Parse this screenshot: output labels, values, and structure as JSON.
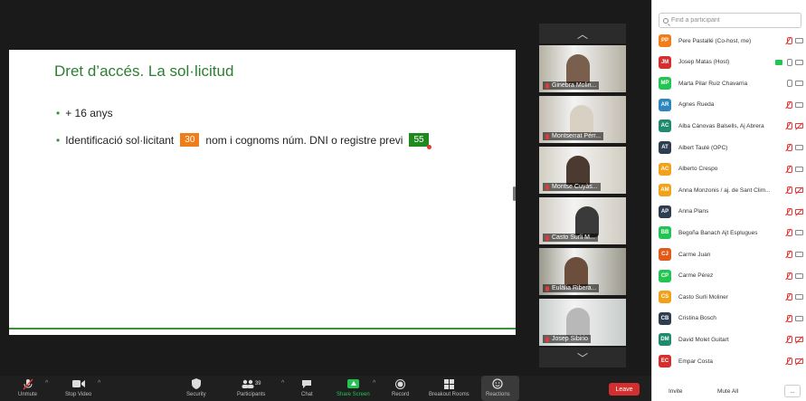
{
  "slide": {
    "title": "Dret d’accés. La sol·licitud",
    "bullet1": "+ 16 anys",
    "bullet2_before": "Identificació sol·licitant",
    "tag1": "30",
    "bullet2_middle": "nom i cognoms núm. DNI o registre previ",
    "tag2": "55",
    "bullet_symbol": "•"
  },
  "video_tiles": [
    {
      "name": "Ginebra Molin..."
    },
    {
      "name": "Montserrat Pérr..."
    },
    {
      "name": "Montse Cuyàs..."
    },
    {
      "name": "Casto Surli M..."
    },
    {
      "name": "Eulàlia Ribera..."
    },
    {
      "name": "Josep Sibirio"
    }
  ],
  "toolbar": {
    "unmute": "Unmute",
    "stop_video": "Stop Video",
    "security": "Security",
    "participants": "Participants",
    "participants_count": "39",
    "chat": "Chat",
    "share_screen": "Share Screen",
    "record": "Record",
    "breakout_rooms": "Breakout Rooms",
    "reactions": "Reactions",
    "leave": "Leave"
  },
  "panel": {
    "search_placeholder": "Find a participant",
    "invite": "Invite",
    "mute_all": "Mute All",
    "more": "..."
  },
  "participants": [
    {
      "initials": "PP",
      "name": "Pere Pastallé (Co-host, me)",
      "color": "#f07c1a",
      "mic": "muted",
      "cam": "on",
      "share": false
    },
    {
      "initials": "JM",
      "name": "Josep Matas (Host)",
      "color": "#d32f2f",
      "mic": "on",
      "cam": "on",
      "share": true
    },
    {
      "initials": "MP",
      "name": "Marta Pilar Ruiz Chavarria",
      "color": "#23c552",
      "mic": "on",
      "cam": "on",
      "share": false
    },
    {
      "initials": "AR",
      "name": "Agnes Rueda",
      "color": "#2e86c1",
      "mic": "muted",
      "cam": "on",
      "share": false
    },
    {
      "initials": "AC",
      "name": "Alba Cánovas Balsells, Aj Abrera",
      "color": "#1e8a6e",
      "mic": "muted",
      "cam": "off",
      "share": false
    },
    {
      "initials": "AT",
      "name": "Albert Taulé (OPC)",
      "color": "#2c3e50",
      "mic": "muted",
      "cam": "on",
      "share": false
    },
    {
      "initials": "AC",
      "name": "Alberto Crespo",
      "color": "#f0a31a",
      "mic": "muted",
      "cam": "on",
      "share": false
    },
    {
      "initials": "AM",
      "name": "Anna Monzonis / aj. de Sant Clim...",
      "color": "#f0a31a",
      "mic": "muted",
      "cam": "off",
      "share": false
    },
    {
      "initials": "AP",
      "name": "Anna Plans",
      "color": "#2c3e50",
      "mic": "muted",
      "cam": "off",
      "share": false
    },
    {
      "initials": "BB",
      "name": "Begoña Banach Ajt Esplugues",
      "color": "#23c552",
      "mic": "muted",
      "cam": "on",
      "share": false
    },
    {
      "initials": "CJ",
      "name": "Carme Juan",
      "color": "#e05a1a",
      "mic": "muted",
      "cam": "on",
      "share": false
    },
    {
      "initials": "CP",
      "name": "Carme Pérez",
      "color": "#23c552",
      "mic": "muted",
      "cam": "on",
      "share": false
    },
    {
      "initials": "CS",
      "name": "Casto Surli Moliner",
      "color": "#f0a31a",
      "mic": "muted",
      "cam": "on",
      "share": false
    },
    {
      "initials": "CB",
      "name": "Cristina Bosch",
      "color": "#2c3e50",
      "mic": "muted",
      "cam": "on",
      "share": false
    },
    {
      "initials": "DM",
      "name": "David Molet Guitart",
      "color": "#1e8a6e",
      "mic": "muted",
      "cam": "off",
      "share": false
    },
    {
      "initials": "EC",
      "name": "Empar Costa",
      "color": "#d32f2f",
      "mic": "muted",
      "cam": "off",
      "share": false
    }
  ]
}
